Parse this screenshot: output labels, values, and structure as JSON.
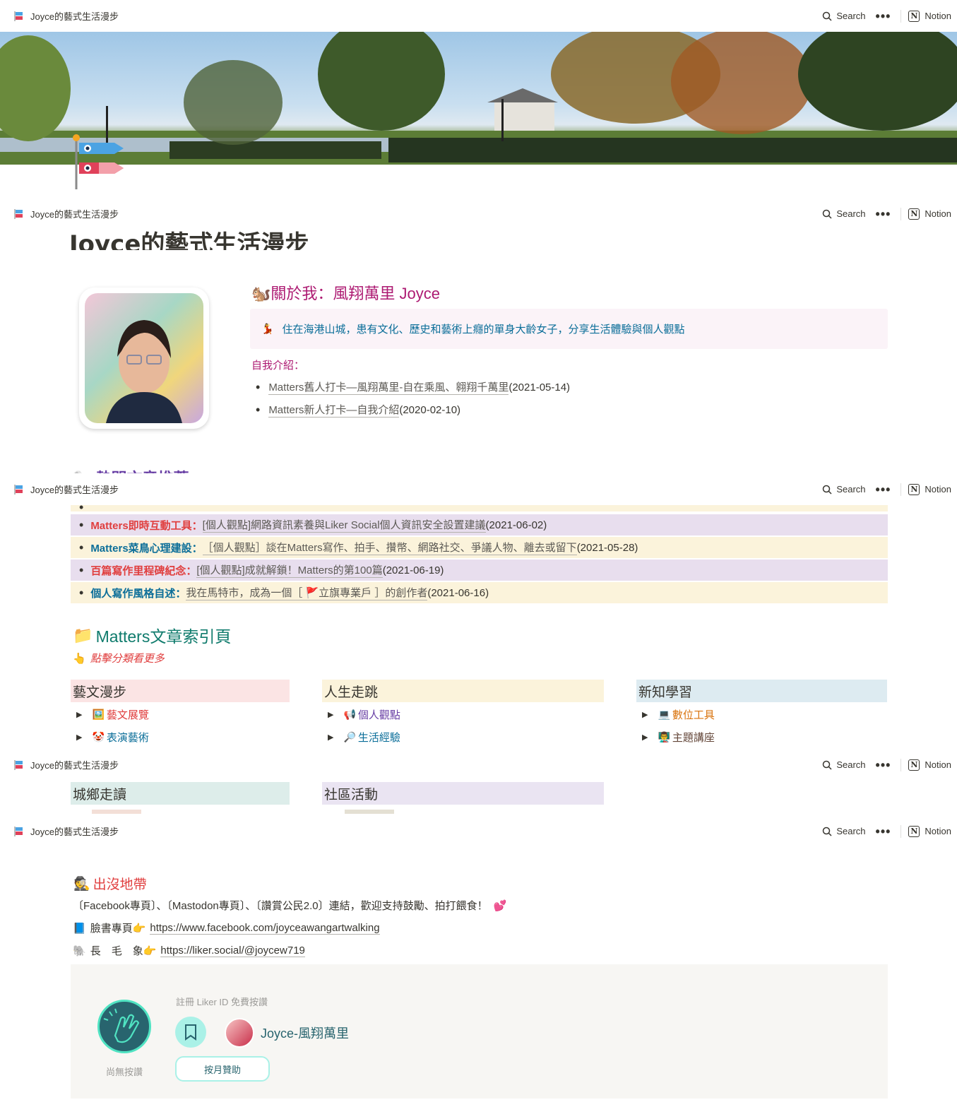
{
  "topbar": {
    "workspace_title": "Joyce的藝式生活漫步",
    "search_label": "Search",
    "more_label": "•••",
    "notion_label": "Notion"
  },
  "page": {
    "title": "Joyce的藝式生活漫步"
  },
  "about": {
    "heading": "關於我：風翔萬里 Joyce",
    "callout": "住在海港山城，患有文化、歷史和藝術上癮的單身大齡女子，分享生活體驗與個人觀點",
    "intro_label": "自我介紹：",
    "items": [
      {
        "link": "Matters舊人打卡—風翔萬里-自在乘風、翱翔千萬里",
        "date": "(2021-05-14)"
      },
      {
        "link": "Matters新人打卡—自我介紹",
        "date": "(2020-02-10)"
      }
    ]
  },
  "highlights": [
    {
      "key": "Matters即時互動工具：",
      "link": "[個人觀點]網路資訊素養與Liker Social個人資訊安全設置建議",
      "date": "(2021-06-02)"
    },
    {
      "key": "Matters菜鳥心理建設：",
      "link": "［個人觀點］談在Matters寫作、拍手、攢幣、網路社交、爭議人物、離去或留下",
      "date": "(2021-05-28)"
    },
    {
      "key": "百篇寫作里程碑紀念：",
      "link": "[個人觀點]成就解鎖！Matters的第100篇",
      "date": "(2021-06-19)"
    },
    {
      "key": "個人寫作風格自述：",
      "link": "我在馬特市，成為一個［ 🚩立旗專業戶 ］的創作者",
      "date": "(2021-06-16)"
    }
  ],
  "index": {
    "title": "Matters文章索引頁",
    "subtitle": "點擊分類看更多",
    "columns": [
      {
        "heading": "藝文漫步",
        "items": [
          {
            "icon": "🖼️",
            "label": "藝文展覽"
          },
          {
            "icon": "🤡",
            "label": "表演藝術"
          }
        ]
      },
      {
        "heading": "人生走跳",
        "items": [
          {
            "icon": "📢",
            "label": "個人觀點"
          },
          {
            "icon": "🔎",
            "label": "生活經驗"
          }
        ]
      },
      {
        "heading": "新知學習",
        "items": [
          {
            "icon": "💻",
            "label": "數位工具"
          },
          {
            "icon": "👨‍🏫",
            "label": "主題講座"
          }
        ]
      }
    ],
    "columns2": [
      {
        "heading": "城鄉走讀"
      },
      {
        "heading": "社區活動"
      }
    ]
  },
  "haunt": {
    "heading": "出沒地帶",
    "intro": "〔Facebook專頁〕、〔Mastodon專頁〕、〔讚賞公民2.0〕連結，歡迎支持鼓勵、拍打餵食！",
    "fb_label": "臉書專頁",
    "fb_url": "https://www.facebook.com/joyceawangartwalking",
    "liker_label": "長　毛　象",
    "liker_url": "https://liker.social/@joycew719"
  },
  "liker": {
    "register": "註冊 Liker ID 免費按讚",
    "no_clap": "尚無按讚",
    "username": "Joyce-風翔萬里",
    "sponsor": "按月贊助"
  },
  "colors": {
    "accent_pink": "#ad1a72",
    "accent_blue": "#0b6e99",
    "accent_red": "#e03e3e",
    "accent_teal": "#0f7b6c",
    "liker_teal": "#28646e"
  }
}
